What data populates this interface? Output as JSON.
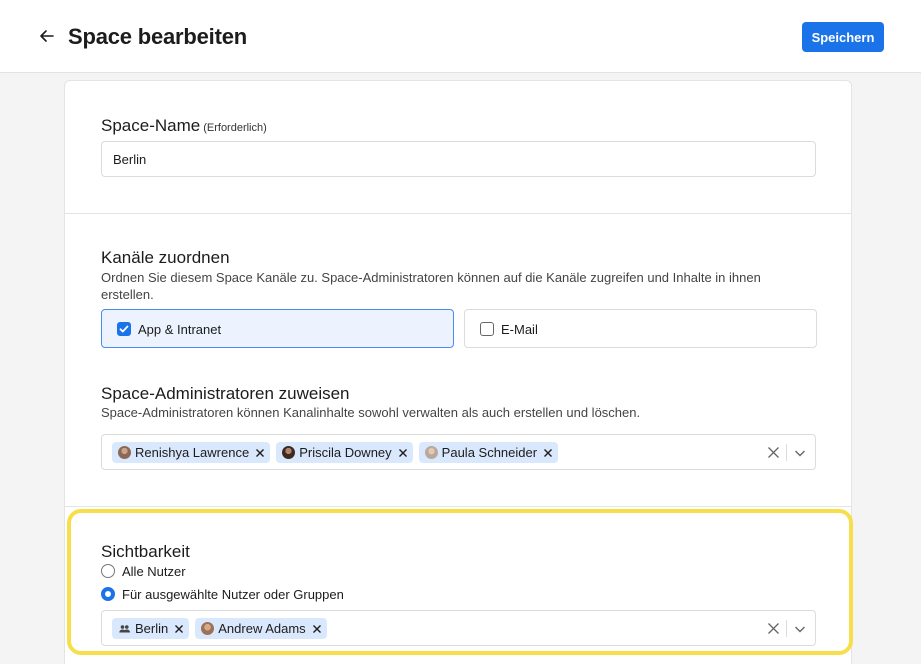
{
  "header": {
    "title": "Space bearbeiten",
    "save_label": "Speichern"
  },
  "space_name": {
    "label": "Space-Name",
    "required": "(Erforderlich)",
    "value": "Berlin"
  },
  "channels": {
    "title": "Kanäle zuordnen",
    "description": "Ordnen Sie diesem Space Kanäle zu. Space-Administratoren können auf die Kanäle zugreifen und Inhalte in ihnen erstellen.",
    "options": [
      {
        "label": "App & Intranet",
        "checked": true
      },
      {
        "label": "E-Mail",
        "checked": false
      }
    ]
  },
  "admins": {
    "title": "Space-Administratoren zuweisen",
    "description": "Space-Administratoren können Kanalinhalte sowohl verwalten als auch erstellen und löschen.",
    "chips": [
      "Renishya Lawrence",
      "Priscila Downey",
      "Paula Schneider"
    ]
  },
  "visibility": {
    "title": "Sichtbarkeit",
    "options": [
      {
        "label": "Alle Nutzer",
        "selected": false
      },
      {
        "label": "Für ausgewählte Nutzer oder Gruppen",
        "selected": true
      }
    ],
    "chips": [
      "Berlin",
      "Andrew Adams"
    ]
  },
  "colors": {
    "primary": "#1a73e8",
    "chip_bg": "#d9e8fc",
    "highlight": "#f7df4c"
  }
}
